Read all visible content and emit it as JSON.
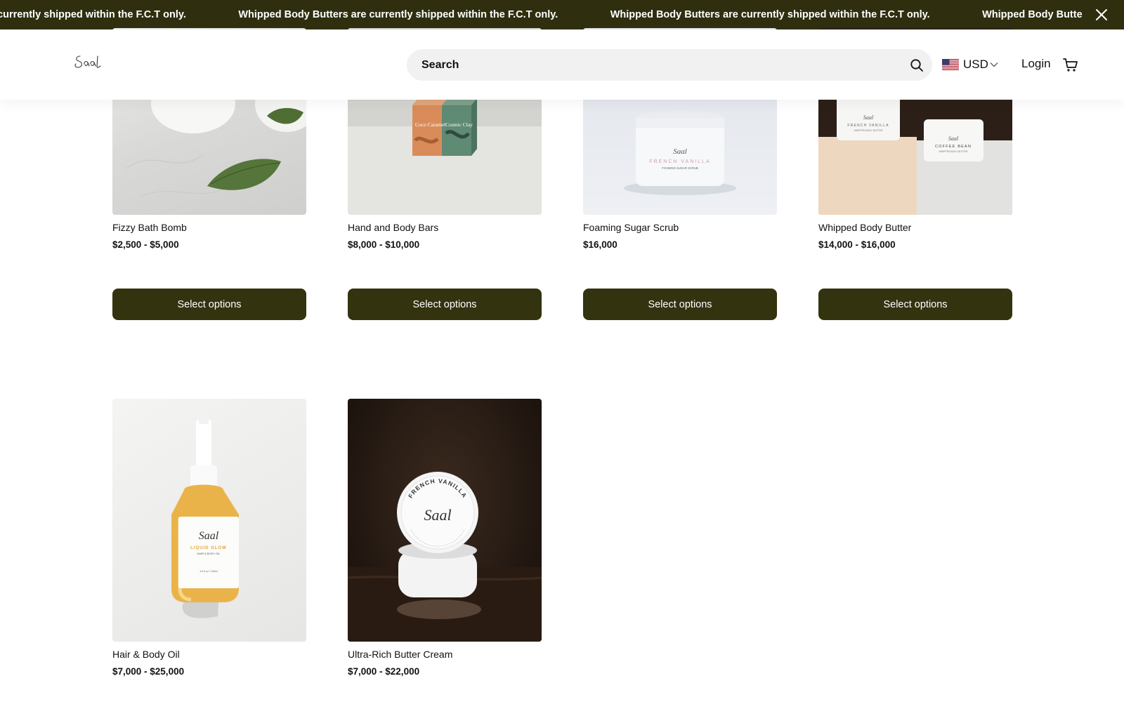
{
  "announcement": {
    "message": "Whipped Body Butters are currently shipped within the F.C.T only.",
    "close_icon": "close-icon",
    "background": "#2f2f10"
  },
  "header": {
    "logo_icon": "brand-logo",
    "search_placeholder": "Search",
    "search_icon": "search-icon",
    "currency": "USD",
    "currency_flag": "us-flag-icon",
    "login_label": "Login",
    "cart_icon": "cart-icon"
  },
  "theme": {
    "button_color": "#333310",
    "button_text_color": "#ffffff"
  },
  "products": [
    {
      "name": "Fizzy Bath Bomb",
      "price": "$2,500 - $5,000",
      "button": "Select options"
    },
    {
      "name": "Hand and Body Bars",
      "price": "$8,000 - $10,000",
      "button": "Select options"
    },
    {
      "name": "Foaming Sugar Scrub",
      "price": "$16,000",
      "button": "Select options"
    },
    {
      "name": "Whipped Body Butter",
      "price": "$14,000 - $16,000",
      "button": "Select options"
    },
    {
      "name": "Hair & Body Oil",
      "price": "$7,000 - $25,000"
    },
    {
      "name": "Ultra-Rich Butter Cream",
      "price": "$7,000 - $22,000"
    }
  ],
  "product_images": {
    "bar_labels": [
      "Coco Caramel",
      "Cosmic Clay"
    ],
    "scrub_jar_label": "FRENCH VANILLA",
    "scrub_jar_sublabel": "FOAMING SUGAR SCRUB",
    "butter_jar_labels": [
      "FRENCH VANILLA",
      "COFFEE BEAN"
    ],
    "butter_jar_sublabel": "WHIPPED BODY BUTTER",
    "oil_label": "LIQUID GLOW",
    "oil_sublabel": "HAIR & BODY OIL",
    "cream_label": "FRENCH VANILLA"
  }
}
